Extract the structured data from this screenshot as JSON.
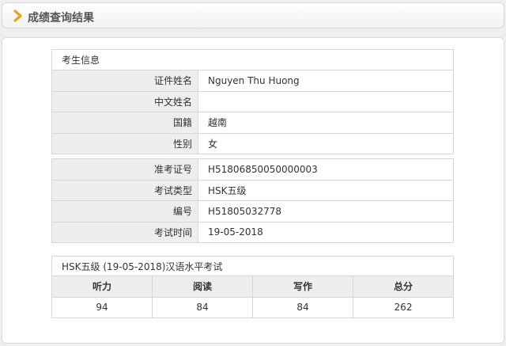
{
  "page": {
    "title": "成绩查询结果",
    "accent_color": "#e8a317"
  },
  "candidate": {
    "section_title": "考生信息",
    "fields": [
      {
        "label": "证件姓名",
        "value": "Nguyen Thu Huong"
      },
      {
        "label": "中文姓名",
        "value": ""
      },
      {
        "label": "国籍",
        "value": "越南"
      },
      {
        "label": "性别",
        "value": "女"
      },
      {
        "label": "准考证号",
        "value": "H51806850050000003"
      },
      {
        "label": "考试类型",
        "value": "HSK五级"
      },
      {
        "label": "编号",
        "value": "H51805032778"
      },
      {
        "label": "考试时间",
        "value": "19-05-2018"
      }
    ]
  },
  "scores": {
    "title": "HSK五级 (19-05-2018)汉语水平考试",
    "headers": [
      "听力",
      "阅读",
      "写作",
      "总分"
    ],
    "values": [
      "94",
      "84",
      "84",
      "262"
    ]
  }
}
